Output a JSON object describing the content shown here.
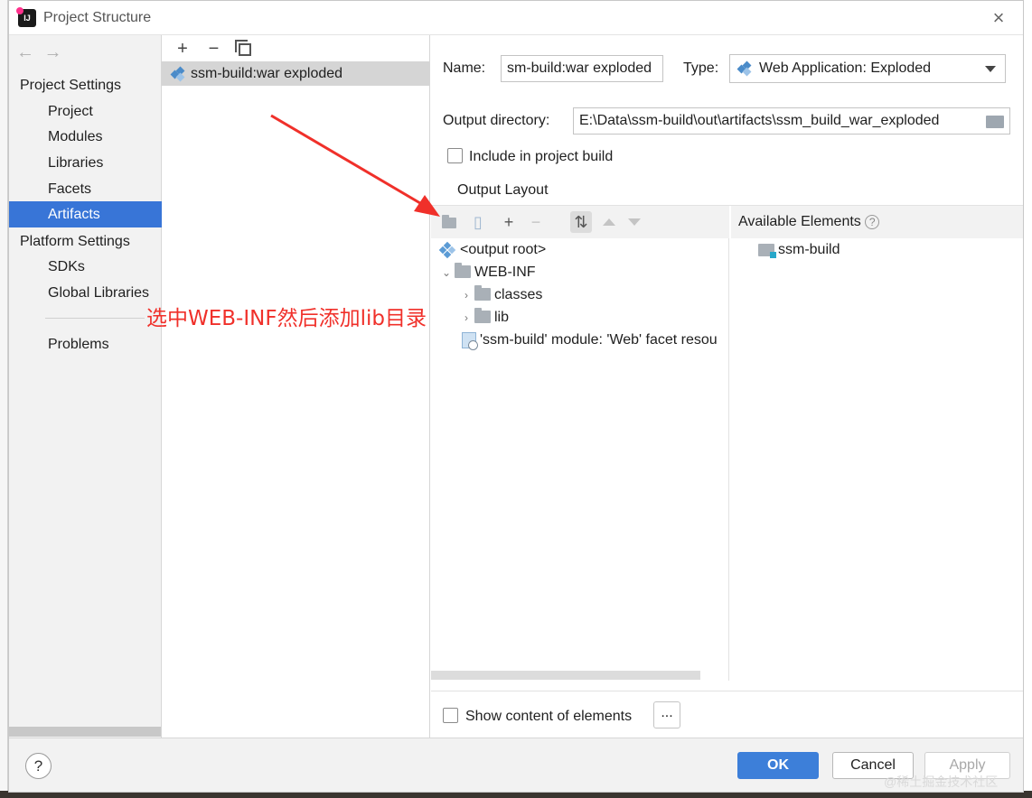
{
  "window": {
    "title": "Project Structure"
  },
  "nav": {
    "project_settings_header": "Project Settings",
    "project_settings_items": [
      "Project",
      "Modules",
      "Libraries",
      "Facets",
      "Artifacts"
    ],
    "platform_settings_header": "Platform Settings",
    "platform_settings_items": [
      "SDKs",
      "Global Libraries"
    ],
    "problems": "Problems",
    "selected": "Artifacts"
  },
  "artifacts_list": {
    "items": [
      "ssm-build:war exploded"
    ]
  },
  "details": {
    "name_label": "Name:",
    "name_value": "sm-build:war exploded",
    "type_label": "Type:",
    "type_value": "Web Application: Exploded",
    "output_dir_label": "Output directory:",
    "output_dir_value": "E:\\Data\\ssm-build\\out\\artifacts\\ssm_build_war_exploded",
    "include_label": "Include in project build",
    "include_checked": false,
    "output_layout_tab": "Output Layout",
    "available_elements_label": "Available Elements",
    "show_content_label": "Show content of elements",
    "ellipsis": "..."
  },
  "tree": {
    "root": "<output root>",
    "web_inf": "WEB-INF",
    "classes": "classes",
    "lib": "lib",
    "facet": "'ssm-build' module: 'Web' facet resou"
  },
  "available": {
    "items": [
      "ssm-build"
    ]
  },
  "footer": {
    "ok": "OK",
    "cancel": "Cancel",
    "apply": "Apply",
    "help": "?"
  },
  "annotation": {
    "text": "选中WEB-INF然后添加lib目录",
    "color": "#f0302a"
  },
  "watermark": "@稀土掘金技术社区",
  "colors": {
    "accent": "#3875d7",
    "primary_button": "#3d7fd9"
  }
}
